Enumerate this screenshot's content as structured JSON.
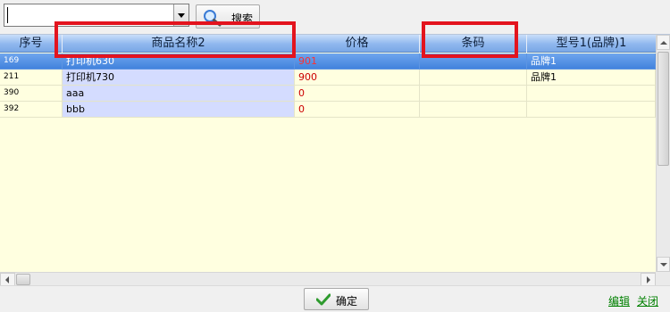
{
  "search": {
    "value": "",
    "button_label": "搜索"
  },
  "table": {
    "columns": [
      {
        "key": "no",
        "label": "序号"
      },
      {
        "key": "name",
        "label": "商品名称2"
      },
      {
        "key": "price",
        "label": "价格"
      },
      {
        "key": "barcode",
        "label": "条码"
      },
      {
        "key": "model",
        "label": "型号1(品牌)1"
      }
    ],
    "rows": [
      {
        "no": "169",
        "name": "打印机630",
        "price": "901",
        "barcode": "",
        "model": "品牌1",
        "selected": true
      },
      {
        "no": "211",
        "name": "打印机730",
        "price": "900",
        "barcode": "",
        "model": "品牌1",
        "selected": false
      },
      {
        "no": "390",
        "name": "aaa",
        "price": "0",
        "barcode": "",
        "model": "",
        "selected": false
      },
      {
        "no": "392",
        "name": "bbb",
        "price": "0",
        "barcode": "",
        "model": "",
        "selected": false
      }
    ]
  },
  "footer": {
    "confirm_label": "确定",
    "edit_label": "编辑",
    "close_label": "关闭"
  },
  "colors": {
    "highlight": "#e3141e",
    "price_text": "#cc0000",
    "link": "#008000",
    "selected_row": "#3f80dc"
  }
}
